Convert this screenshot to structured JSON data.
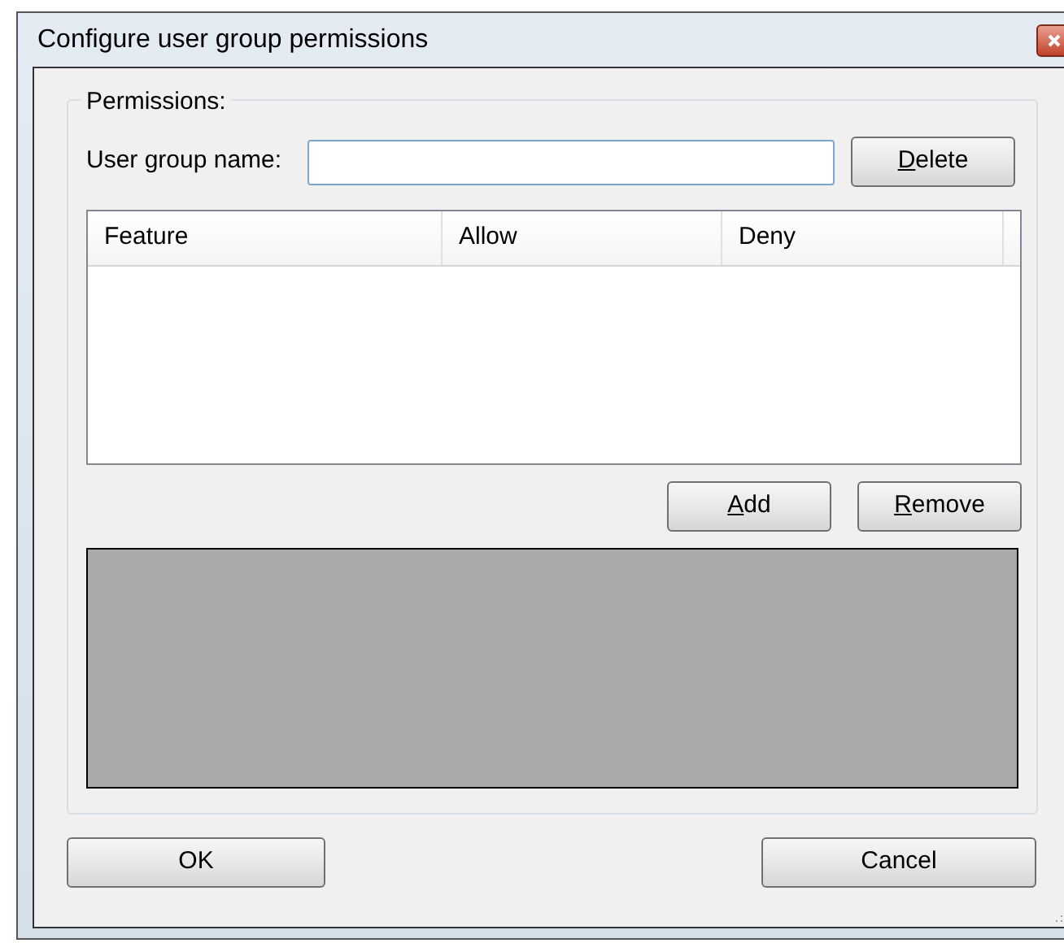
{
  "window": {
    "title": "Configure user group permissions"
  },
  "group": {
    "label": "Permissions:"
  },
  "user_group_name": {
    "label": "User group name:"
  },
  "delete_button": {
    "mnemonic": "D",
    "rest": "elete"
  },
  "table": {
    "columns": [
      "Feature",
      "Allow",
      "Deny"
    ]
  },
  "list_buttons": [
    {
      "mnemonic": "A",
      "rest": "dd"
    },
    {
      "mnemonic": "R",
      "rest": "emove"
    }
  ],
  "footer_buttons": [
    "OK",
    "Cancel"
  ]
}
